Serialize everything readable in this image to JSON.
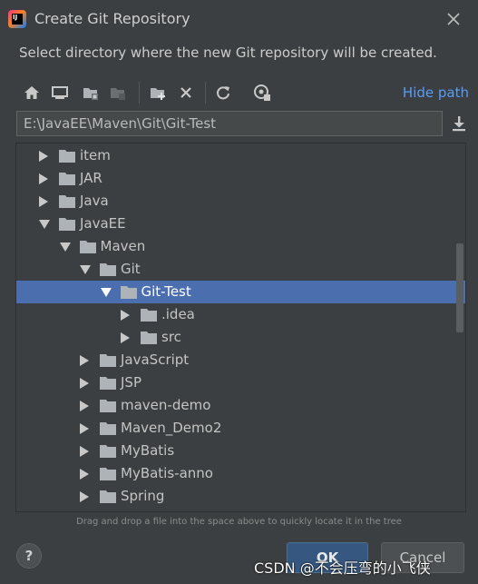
{
  "window": {
    "title": "Create Git Repository",
    "close_icon": "close-icon"
  },
  "subtitle": "Select directory where the new Git repository will be created.",
  "toolbar": {
    "icons": [
      "home-icon",
      "desktop-icon",
      "project-folder-icon",
      "module-folder-icon",
      "new-folder-icon",
      "delete-icon",
      "refresh-icon",
      "show-hidden-icon"
    ],
    "hide_path_label": "Hide path"
  },
  "path": {
    "value": "E:\\JavaEE\\Maven\\Git\\Git-Test"
  },
  "tree": {
    "rows": [
      {
        "label": "item",
        "expanded": false,
        "depth": 0
      },
      {
        "label": "JAR",
        "expanded": false,
        "depth": 0
      },
      {
        "label": "Java",
        "expanded": false,
        "depth": 0
      },
      {
        "label": "JavaEE",
        "expanded": true,
        "depth": 0
      },
      {
        "label": "Maven",
        "expanded": true,
        "depth": 1
      },
      {
        "label": "Git",
        "expanded": true,
        "depth": 2
      },
      {
        "label": "Git-Test",
        "expanded": true,
        "depth": 3,
        "selected": true
      },
      {
        "label": ".idea",
        "expanded": false,
        "depth": 4
      },
      {
        "label": "src",
        "expanded": false,
        "depth": 4
      },
      {
        "label": "JavaScript",
        "expanded": false,
        "depth": 2
      },
      {
        "label": "JSP",
        "expanded": false,
        "depth": 2
      },
      {
        "label": "maven-demo",
        "expanded": false,
        "depth": 2
      },
      {
        "label": "Maven_Demo2",
        "expanded": false,
        "depth": 2
      },
      {
        "label": "MyBatis",
        "expanded": false,
        "depth": 2
      },
      {
        "label": "MyBatis-anno",
        "expanded": false,
        "depth": 2
      },
      {
        "label": "Spring",
        "expanded": false,
        "depth": 2
      }
    ]
  },
  "hint": "Drag and drop a file into the space above to quickly locate it in the tree",
  "buttons": {
    "help": "?",
    "ok": "OK",
    "cancel": "Cancel"
  },
  "watermark": "CSDN @不会压弯的小飞侠",
  "colors": {
    "background": "#3c3f41",
    "selection": "#4b6eaf",
    "link": "#589df6",
    "primary_button": "#365880"
  }
}
